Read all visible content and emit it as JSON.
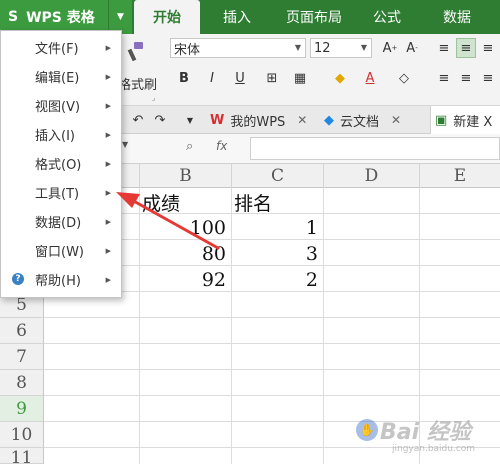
{
  "app": {
    "logo": "S",
    "title": "WPS 表格"
  },
  "ribbon_tabs": [
    "开始",
    "插入",
    "页面布局",
    "公式",
    "数据"
  ],
  "ribbon": {
    "font_name": "宋体",
    "font_size": "12",
    "format_painter_label": "格式刷",
    "bold": "B",
    "italic": "I",
    "underline": "U",
    "font_color_glyph": "A"
  },
  "doc_tabs": [
    {
      "label": "我的WPS"
    },
    {
      "label": "云文档"
    },
    {
      "label": "新建 X"
    }
  ],
  "formula_bar": {
    "fx": "fx"
  },
  "menu": {
    "items": [
      {
        "label": "文件(F)"
      },
      {
        "label": "编辑(E)"
      },
      {
        "label": "视图(V)"
      },
      {
        "label": "插入(I)"
      },
      {
        "label": "格式(O)"
      },
      {
        "label": "工具(T)"
      },
      {
        "label": "数据(D)"
      },
      {
        "label": "窗口(W)"
      },
      {
        "label": "帮助(H)"
      }
    ]
  },
  "sheet": {
    "columns": [
      "B",
      "C",
      "D",
      "E"
    ],
    "rows": [
      "5",
      "6",
      "7",
      "8",
      "9",
      "10",
      "11"
    ],
    "header_b": "成绩",
    "header_c": "排名",
    "data": [
      {
        "score": "100",
        "rank": "1"
      },
      {
        "score": "80",
        "rank": "3"
      },
      {
        "score": "92",
        "rank": "2"
      }
    ]
  },
  "watermark": {
    "text": "Bai 经验",
    "sub": "jingyan.baidu.com"
  },
  "colors": {
    "brand_green": "#2e7d32",
    "annotation_red": "#e53935"
  }
}
